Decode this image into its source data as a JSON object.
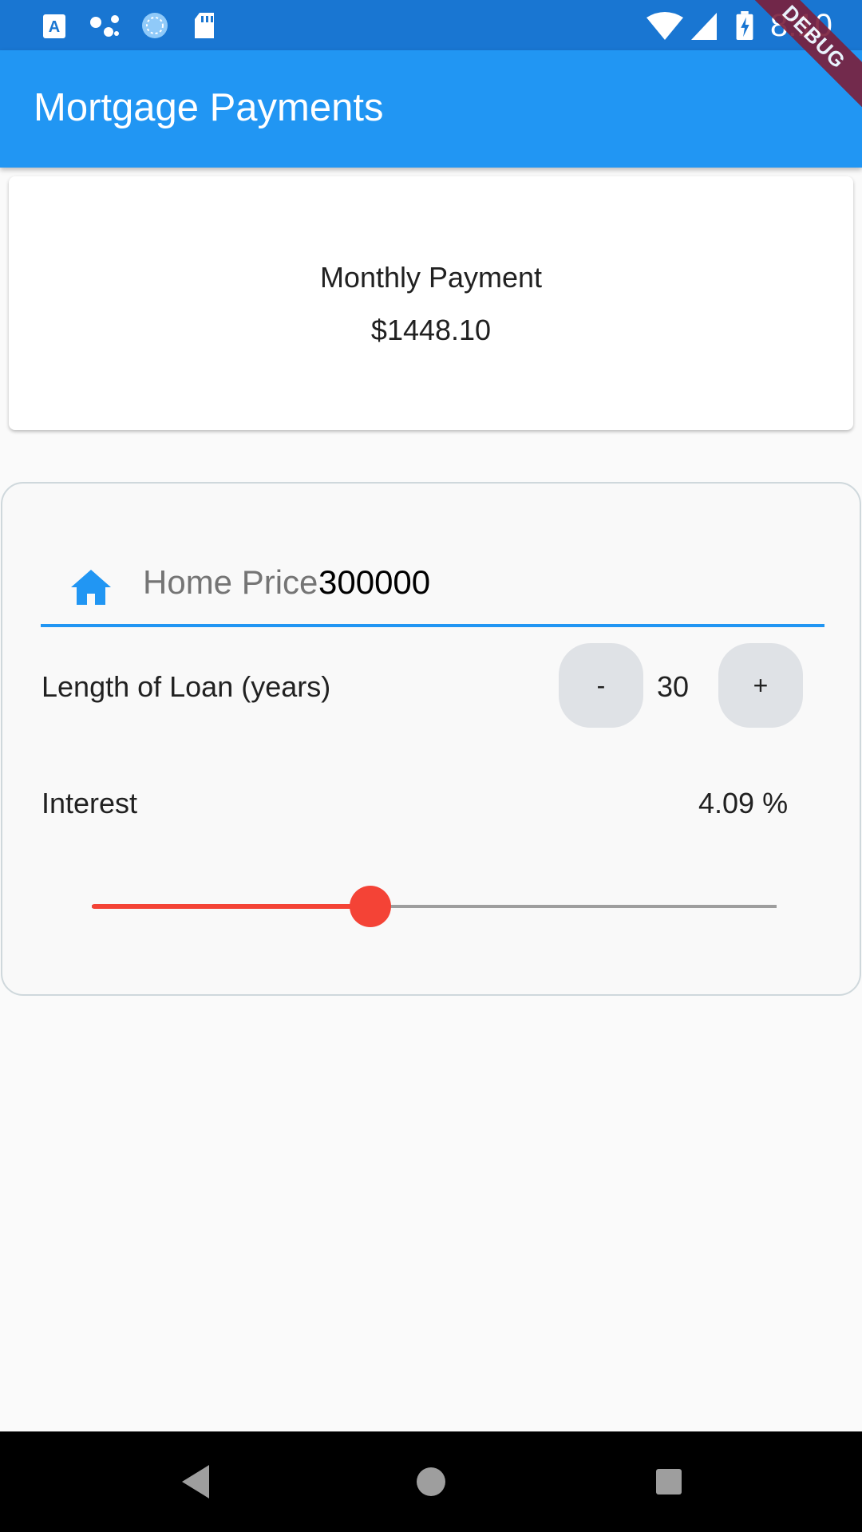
{
  "status_bar": {
    "time": "8:10",
    "icons": [
      "keyboard-a-icon",
      "assistant-dots-icon",
      "sync-circle-icon",
      "sd-card-icon",
      "wifi-icon",
      "signal-icon",
      "battery-charging-icon"
    ]
  },
  "app_bar": {
    "title": "Mortgage Payments",
    "debug_banner": "DEBUG"
  },
  "payment_card": {
    "label": "Monthly Payment",
    "value": "$1448.10"
  },
  "form": {
    "home_price_label": "Home Price",
    "home_price_value": "300000",
    "loan_length_label": "Length of Loan (years)",
    "decrement_label": "-",
    "loan_years": "30",
    "increment_label": "+",
    "interest_label": "Interest",
    "interest_value": "4.09 %",
    "interest_slider_fraction": 0.407
  },
  "colors": {
    "primary": "#2196f3",
    "status_bar": "#1976d2",
    "slider_accent": "#f44336"
  },
  "nav_bar": {
    "icons": [
      "back-icon",
      "home-circle-icon",
      "recents-square-icon"
    ]
  }
}
